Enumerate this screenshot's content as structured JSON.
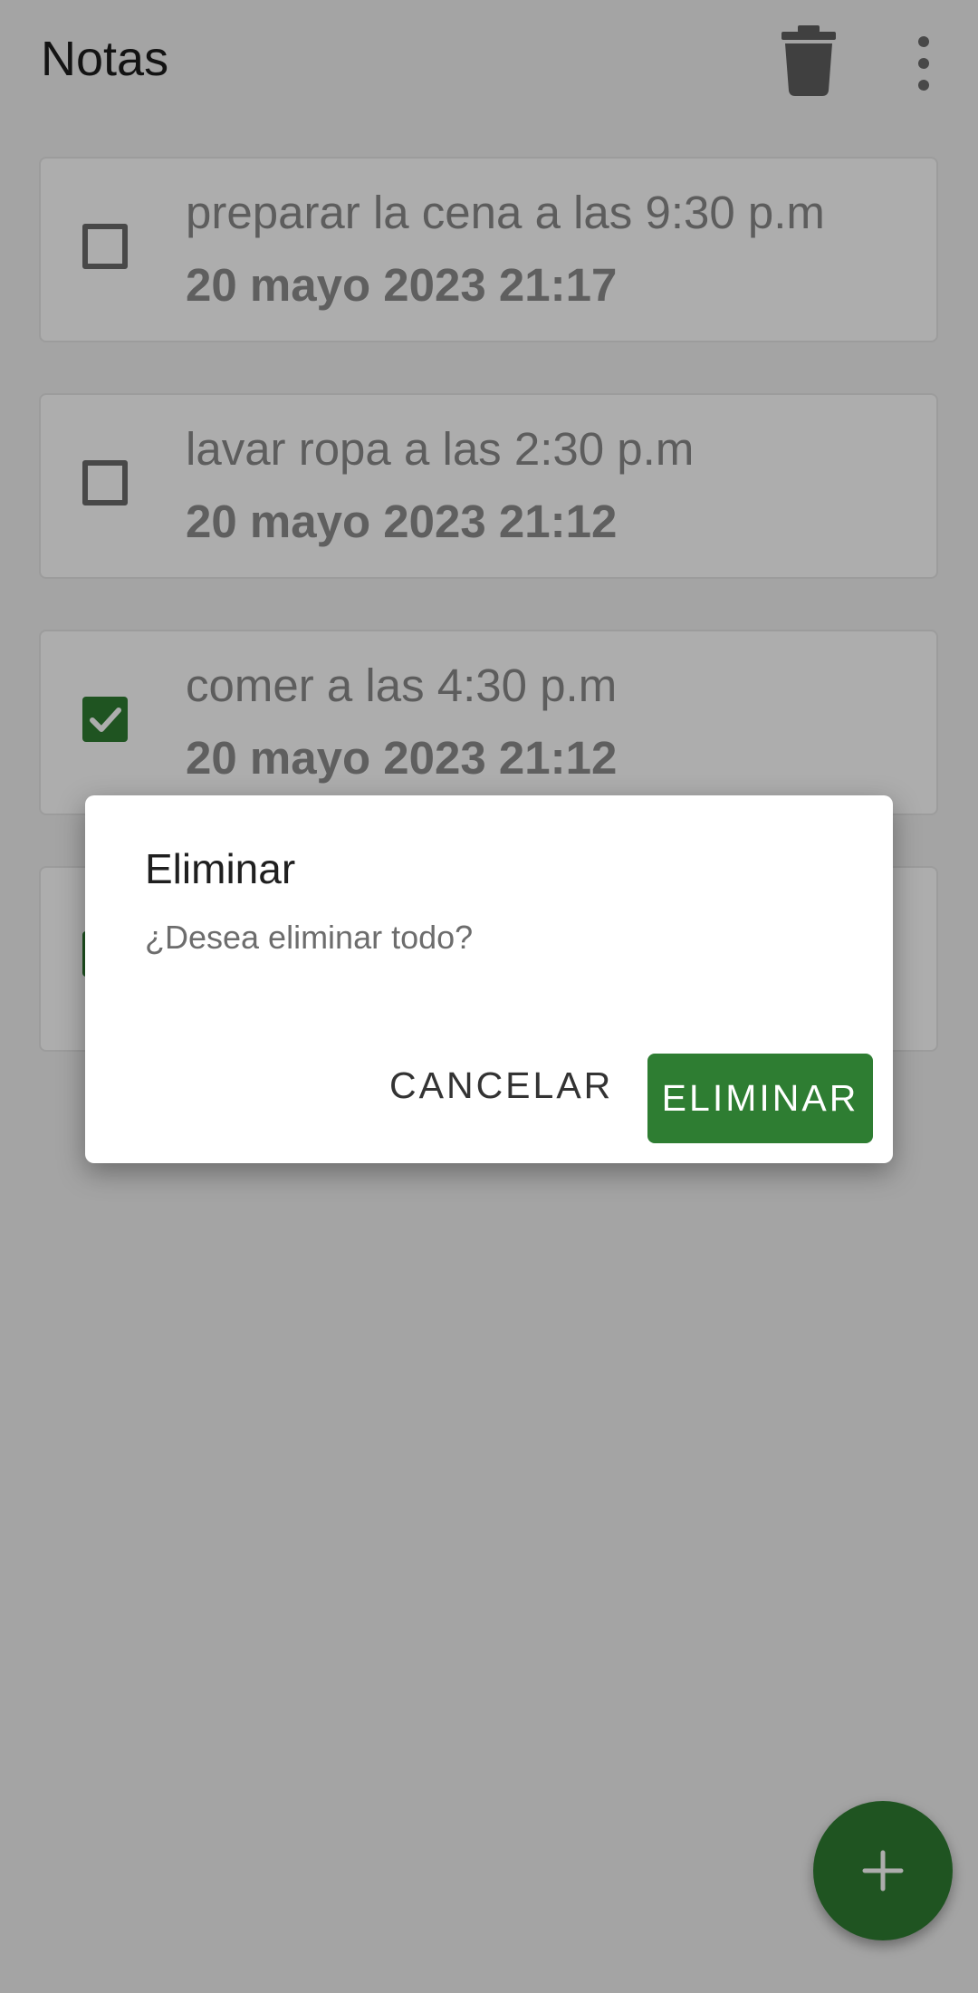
{
  "app": {
    "title": "Notas",
    "accent_color": "#2e7d32",
    "toolbar_icons": [
      "trash-icon",
      "more-vert-icon"
    ]
  },
  "notes": [
    {
      "text": "preparar la cena a las 9:30 p.m",
      "date": "20 mayo 2023 21:17",
      "checked": false
    },
    {
      "text": "lavar ropa a las 2:30 p.m",
      "date": "20 mayo 2023 21:12",
      "checked": false
    },
    {
      "text": "comer a las 4:30 p.m",
      "date": "20 mayo 2023 21:12",
      "checked": true
    },
    {
      "text": "",
      "date": "",
      "checked": true
    }
  ],
  "dialog": {
    "title": "Eliminar",
    "message": "¿Desea eliminar todo?",
    "cancel_label": "CANCELAR",
    "confirm_label": "ELIMINAR"
  },
  "fab": {
    "icon": "plus-icon"
  }
}
